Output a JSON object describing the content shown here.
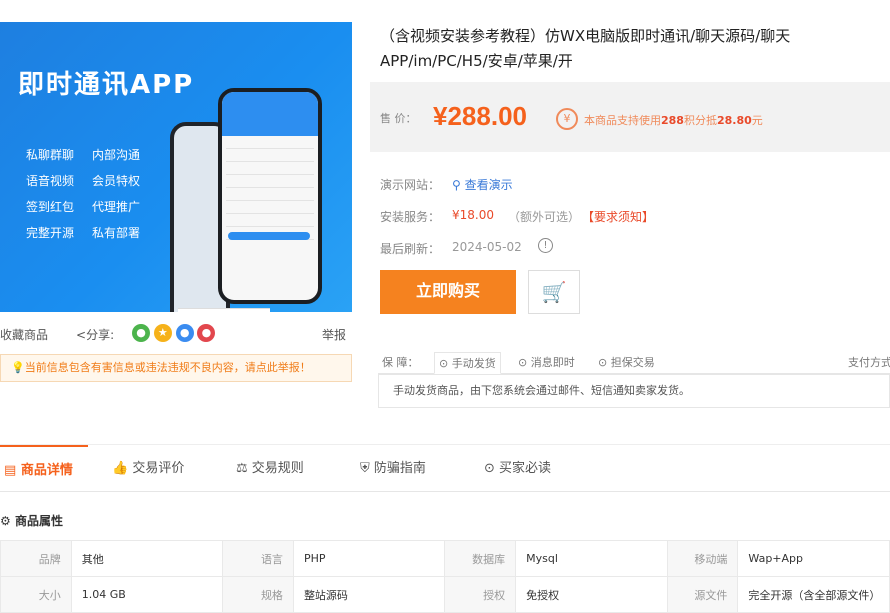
{
  "banner": {
    "title": "即时通讯APP",
    "features": [
      [
        "私聊群聊",
        "内部沟通"
      ],
      [
        "语音视频",
        "会员特权"
      ],
      [
        "签到红包",
        "代理推广"
      ],
      [
        "完整开源",
        "私有部署"
      ]
    ]
  },
  "share": {
    "favorite": "收藏商品",
    "share_label": "分享:",
    "report": "举报"
  },
  "notice": "当前信息包含有害信息或违法违规不良内容，请点此举报！",
  "product": {
    "title": "（含视频安装参考教程）仿WX电脑版即时通讯/聊天源码/聊天APP/im/PC/H5/安卓/苹果/开",
    "price_label": "售  价：",
    "price": "¥288.00",
    "points_text_prefix": "本商品支持使用",
    "points_amount": "288",
    "points_text_mid": "积分抵",
    "points_value": "28.80",
    "points_text_suffix": "元",
    "demo_label": "演示网站：",
    "demo_link": "查看演示",
    "install_label": "安装服务：",
    "install_price": "¥18.00",
    "install_note": "（额外可选）",
    "install_link": "【要求须知】",
    "update_label": "最后刷新：",
    "update_date": "2024-05-02",
    "buy_button": "立即购买"
  },
  "guarantee": {
    "label": "保  障：",
    "items": [
      "手动发货",
      "消息即时",
      "担保交易"
    ],
    "payment": "支付方式",
    "description": "手动发货商品，由下您系统会通过邮件、短信通知卖家发货。"
  },
  "tabs": [
    "商品详情",
    "交易评价",
    "交易规则",
    "防骗指南",
    "买家必读"
  ],
  "attributes": {
    "title": "商品属性",
    "rows": [
      [
        [
          "品牌",
          "其他"
        ],
        [
          "语言",
          "PHP"
        ],
        [
          "数据库",
          "Mysql"
        ],
        [
          "移动端",
          "Wap+App"
        ]
      ],
      [
        [
          "大小",
          "1.04 GB"
        ],
        [
          "规格",
          "整站源码"
        ],
        [
          "授权",
          "免授权"
        ],
        [
          "源文件",
          "完全开源（含全部源文件）"
        ]
      ]
    ]
  },
  "colors": {
    "accent": "#f5611c",
    "buy": "#f5821f",
    "banner": "#1a8ef0"
  }
}
